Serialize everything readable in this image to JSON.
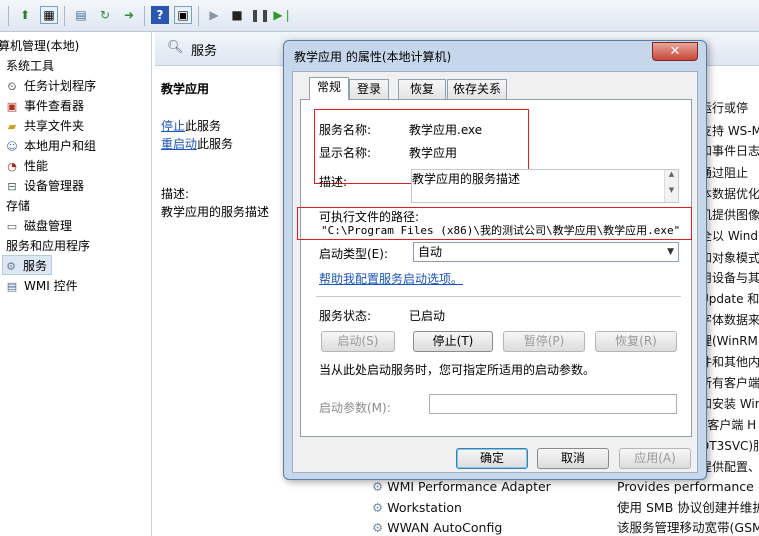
{
  "toolbar": {
    "icons": [
      "folder-up-icon",
      "properties-icon",
      "show-hide-tree-icon",
      "export-icon",
      "refresh-icon",
      "help-icon",
      "action-pane-icon",
      "play-icon",
      "stop-icon",
      "pause-icon",
      "restart-icon"
    ]
  },
  "tree": {
    "root": "算机管理(本地)",
    "system_tools": "系统工具",
    "items": [
      "任务计划程序",
      "事件查看器",
      "共享文件夹",
      "本地用户和组",
      "性能",
      "设备管理器"
    ],
    "storage": "存储",
    "disk_mgmt": "磁盘管理",
    "services_apps": "服务和应用程序",
    "services": "服务",
    "wmi": "WMI 控件"
  },
  "middle": {
    "header_title": "服务",
    "selected_service": "教学应用",
    "stop_link": "停止",
    "stop_suffix": "此服务",
    "restart_link": "重启动",
    "restart_suffix": "此服务",
    "desc_label": "描述:",
    "desc_text": "教学应用的服务描述",
    "right_descs": [
      "运行或停",
      "支持 WS-M",
      "和事件日志",
      "通过阻止",
      "本数据优化",
      "机提供图像",
      "全以 Wind",
      "和对象模式",
      "用设备与其",
      "Update 和",
      "字体数据来",
      "理(WinRM",
      "件和其他内",
      "所有客户端",
      "和安装 Win",
      "Y客户端 H",
      "DT3SVC)服",
      "提供配置、"
    ],
    "services_list": [
      {
        "name": "WMI Performance Adapter",
        "desc": "Provides performance lib"
      },
      {
        "name": "Workstation",
        "desc": "使用 SMB 协议创建并维护"
      },
      {
        "name": "WWAN AutoConfig",
        "desc": "该服务管理移动宽带(GSM"
      }
    ]
  },
  "dialog": {
    "title": "教学应用 的属性(本地计算机)",
    "close": "✕",
    "tabs": [
      "常规",
      "登录",
      "恢复",
      "依存关系"
    ],
    "service_name_label": "服务名称:",
    "service_name": "教学应用.exe",
    "display_name_label": "显示名称:",
    "display_name": "教学应用",
    "description_label": "描述:",
    "description": "教学应用的服务描述",
    "exe_path_label": "可执行文件的路径:",
    "exe_path": "\"C:\\Program Files (x86)\\我的测试公司\\教学应用\\教学应用.exe\"",
    "startup_type_label": "启动类型(E):",
    "startup_type": "自动",
    "help_link": "帮助我配置服务启动选项。",
    "status_label": "服务状态:",
    "status": "已启动",
    "btn_start": "启动(S)",
    "btn_stop": "停止(T)",
    "btn_pause": "暂停(P)",
    "btn_resume": "恢复(R)",
    "hint": "当从此处启动服务时，您可指定所适用的启动参数。",
    "params_label": "启动参数(M):",
    "params_value": "",
    "ok": "确定",
    "cancel": "取消",
    "apply": "应用(A)"
  }
}
